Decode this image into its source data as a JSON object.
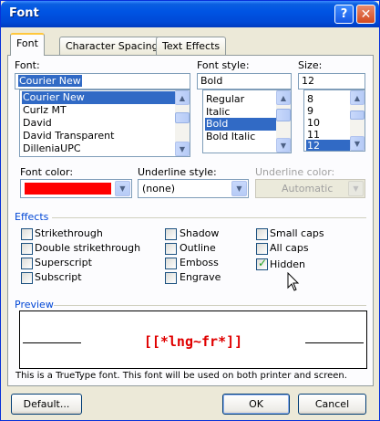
{
  "window": {
    "title": "Font",
    "help_glyph": "?",
    "close_glyph": "✕"
  },
  "tabs": [
    {
      "label": "Font",
      "active": true
    },
    {
      "label": "Character Spacing",
      "active": false
    },
    {
      "label": "Text Effects",
      "active": false
    }
  ],
  "font": {
    "label": "Font:",
    "value": "Courier New",
    "items": [
      "Courier New",
      "Curlz MT",
      "David",
      "David Transparent",
      "DilleniaUPC"
    ],
    "selected": "Courier New"
  },
  "font_style": {
    "label": "Font style:",
    "value": "Bold",
    "items": [
      "Regular",
      "Italic",
      "Bold",
      "Bold Italic"
    ],
    "selected": "Bold"
  },
  "size": {
    "label": "Size:",
    "value": "12",
    "items": [
      "8",
      "9",
      "10",
      "11",
      "12"
    ],
    "selected": "12"
  },
  "font_color": {
    "label": "Font color:",
    "color": "#ff0000"
  },
  "underline_style": {
    "label": "Underline style:",
    "value": "(none)"
  },
  "underline_color": {
    "label": "Underline color:",
    "value": "Automatic",
    "disabled": true
  },
  "effects": {
    "label": "Effects",
    "items": [
      {
        "label": "Strikethrough",
        "checked": false
      },
      {
        "label": "Double strikethrough",
        "checked": false
      },
      {
        "label": "Superscript",
        "checked": false
      },
      {
        "label": "Subscript",
        "checked": false
      },
      {
        "label": "Shadow",
        "checked": false
      },
      {
        "label": "Outline",
        "checked": false
      },
      {
        "label": "Emboss",
        "checked": false
      },
      {
        "label": "Engrave",
        "checked": false
      },
      {
        "label": "Small caps",
        "checked": false
      },
      {
        "label": "All caps",
        "checked": false
      },
      {
        "label": "Hidden",
        "checked": true
      }
    ]
  },
  "preview": {
    "label": "Preview",
    "text": "[[*lng~fr*]]",
    "text_color": "#e00000",
    "note": "This is a TrueType font. This font will be used on both printer and screen."
  },
  "buttons": {
    "default": "Default...",
    "ok": "OK",
    "cancel": "Cancel"
  },
  "colors": {
    "title_bar": "#0054e3",
    "dialog_bg": "#ece9d8",
    "selection": "#316ac5"
  }
}
